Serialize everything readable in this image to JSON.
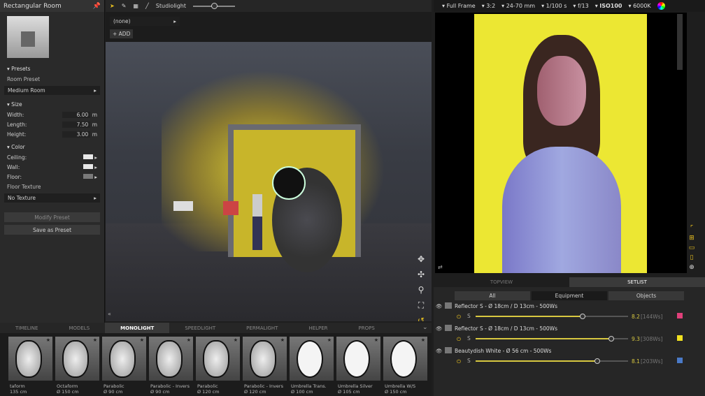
{
  "left": {
    "title": "Rectangular Room",
    "presets_header": "Presets",
    "room_preset_label": "Room Preset",
    "room_preset": "Medium Room",
    "size_header": "Size",
    "width_label": "Width:",
    "width": "6.00",
    "length_label": "Length:",
    "length": "7.50",
    "height_label": "Height:",
    "height": "3.00",
    "unit": "m",
    "color_header": "Color",
    "ceiling_label": "Ceiling:",
    "wall_label": "Wall:",
    "floor_label": "Floor:",
    "floor_texture_label": "Floor Texture",
    "floor_texture": "No Texture",
    "modify_preset": "Modify Preset",
    "save_preset": "Save as Preset",
    "colors": {
      "ceiling": "#e8e8e8",
      "wall": "#e8e8e8",
      "floor": "#7a7a7a"
    }
  },
  "toolbar": {
    "scene": "Studiolight",
    "camera_select": "(none)",
    "add": "+ ADD"
  },
  "camera_bar": {
    "sensor": "Full Frame",
    "ratio": "3:2",
    "lens": "24-70 mm",
    "shutter": "1/100 s",
    "aperture": "f/13",
    "iso": "ISO100",
    "wb": "6000K"
  },
  "right": {
    "tabs": [
      "TOPVIEW",
      "SETLIST"
    ],
    "filters": [
      "All",
      "Equipment",
      "Objects"
    ],
    "lights": [
      {
        "name": "Reflector S - Ø 18cm / D 13cm - 500Ws",
        "s": "S",
        "value": "8.2",
        "ws": "[144Ws]",
        "color": "#e0407a",
        "level": 0.7
      },
      {
        "name": "Reflector S - Ø 18cm / D 13cm - 500Ws",
        "s": "S",
        "value": "9.3",
        "ws": "[308Ws]",
        "color": "#f0e020",
        "level": 0.89
      },
      {
        "name": "Beautydish White - Ø 56 cm - 500Ws",
        "s": "S",
        "value": "8.1",
        "ws": "[203Ws]",
        "color": "#4a7ac8",
        "level": 0.8
      }
    ]
  },
  "bottom": {
    "tabs": [
      "TIMELINE",
      "MODELS",
      "MONOLIGHT",
      "SPEEDLIGHT",
      "PERMALIGHT",
      "HELPER",
      "PROPS"
    ],
    "items": [
      {
        "n": "taform",
        "s": "135 cm"
      },
      {
        "n": "Octaform",
        "s": "Ø 150 cm"
      },
      {
        "n": "Parabolic",
        "s": "Ø 90 cm"
      },
      {
        "n": "Parabolic - Invers",
        "s": "Ø 90 cm"
      },
      {
        "n": "Parabolic",
        "s": "Ø 120 cm"
      },
      {
        "n": "Parabolic - Invers",
        "s": "Ø 120 cm"
      },
      {
        "n": "Umbrella Trans.",
        "s": "Ø 100 cm"
      },
      {
        "n": "Umbrella Silver",
        "s": "Ø 105 cm"
      },
      {
        "n": "Umbrella W/S",
        "s": "Ø 150 cm"
      }
    ]
  }
}
